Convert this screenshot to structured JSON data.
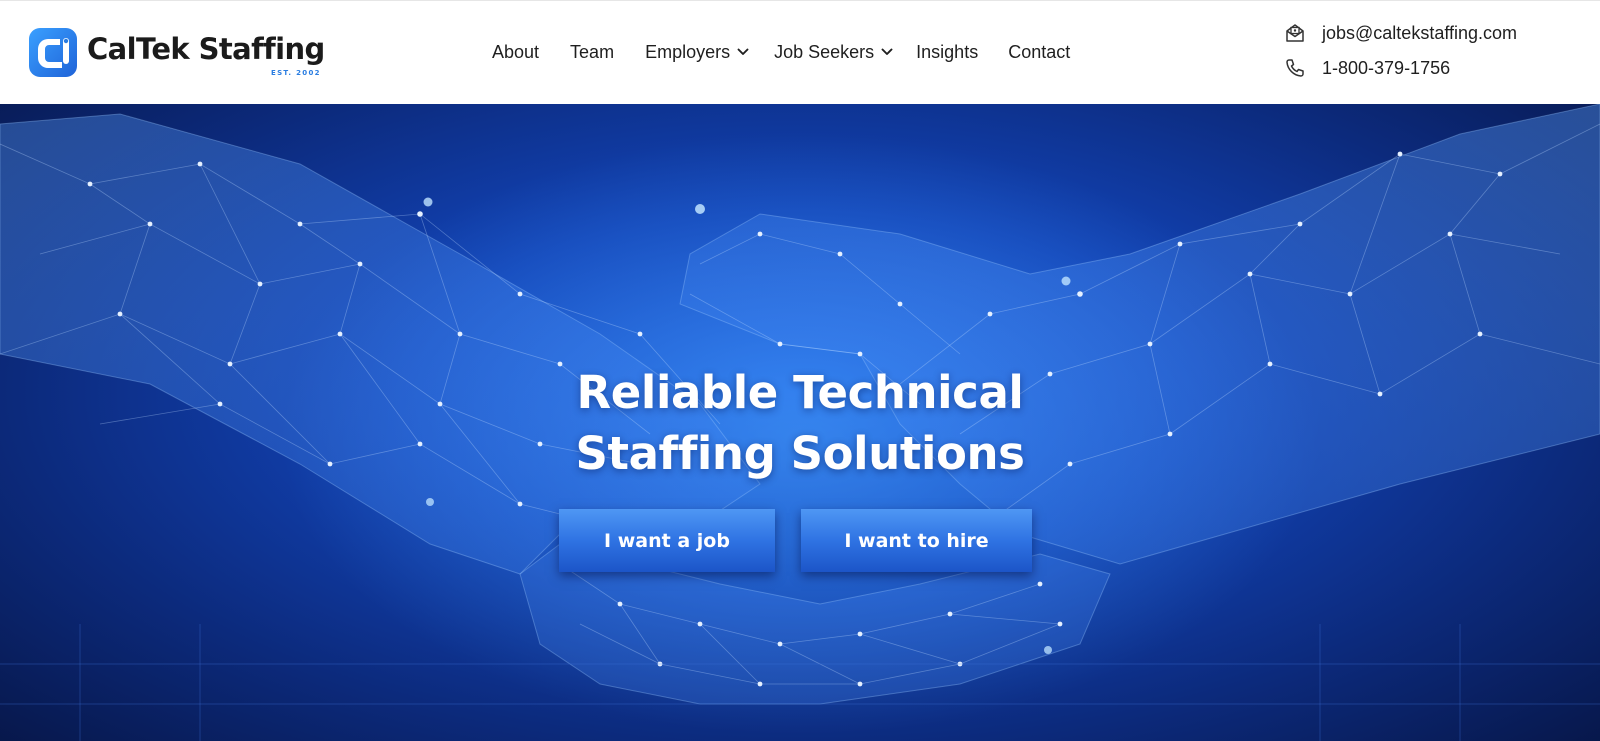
{
  "brand": {
    "name": "CalTek Staffing",
    "established": "EST. 2002",
    "mark_icon": "caltek-logo-mark",
    "colors": {
      "mark": "#2a7de1",
      "text": "#1b1b1b"
    }
  },
  "nav": {
    "items": [
      {
        "label": "About",
        "has_dropdown": false
      },
      {
        "label": "Team",
        "has_dropdown": false
      },
      {
        "label": "Employers",
        "has_dropdown": true
      },
      {
        "label": "Job Seekers",
        "has_dropdown": true
      },
      {
        "label": "Insights",
        "has_dropdown": false
      },
      {
        "label": "Contact",
        "has_dropdown": false
      }
    ]
  },
  "contact": {
    "email": "jobs@caltekstaffing.com",
    "email_icon": "mail-icon",
    "phone": "1-800-379-1756",
    "phone_icon": "phone-icon"
  },
  "hero": {
    "title_line1": "Reliable Technical",
    "title_line2": "Staffing Solutions",
    "background": "network-handshake-image",
    "buttons": {
      "job": "I want a job",
      "hire": "I want to hire"
    },
    "colors": {
      "background": "#1244b8",
      "button_top": "#4f97f4",
      "button_bottom": "#1c55c8",
      "title": "#ffffff"
    }
  }
}
